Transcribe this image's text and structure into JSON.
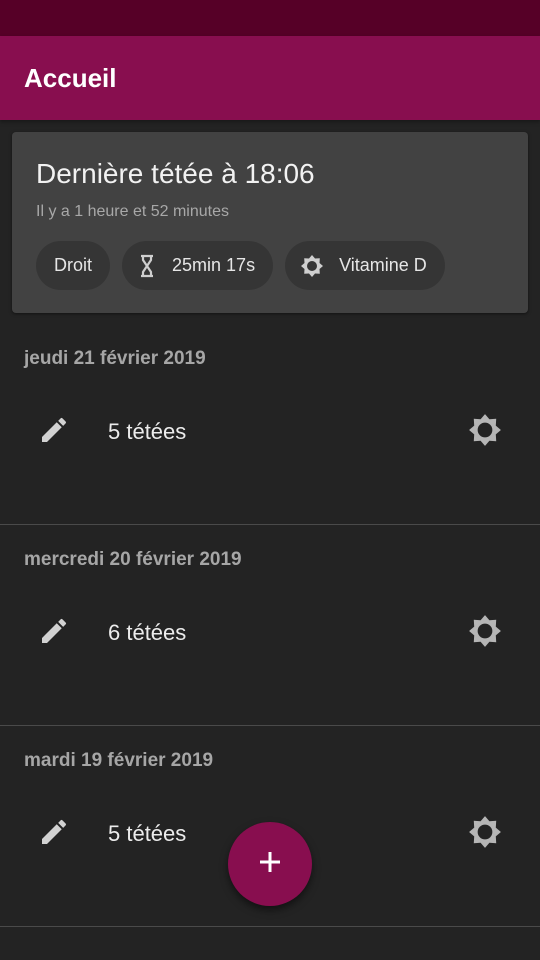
{
  "app": {
    "title": "Accueil"
  },
  "last_feeding": {
    "title": "Dernière tétée à 18:06",
    "subtitle": "Il y a 1 heure et 52 minutes",
    "chips": {
      "side": "Droit",
      "duration": "25min 17s",
      "vitamin": "Vitamine D"
    }
  },
  "days": [
    {
      "date": "jeudi 21 février 2019",
      "count": "5 tétées"
    },
    {
      "date": "mercredi 20 février 2019",
      "count": "6 tétées"
    },
    {
      "date": "mardi 19 février 2019",
      "count": "5 tétées"
    }
  ],
  "icons": {
    "edit": "pencil-icon",
    "vitamin": "sun-icon",
    "duration": "hourglass-icon",
    "fab": "plus-icon"
  },
  "colors": {
    "primary": "#880e4f",
    "primary_dark": "#560027",
    "background": "#232323",
    "card": "#424242"
  }
}
